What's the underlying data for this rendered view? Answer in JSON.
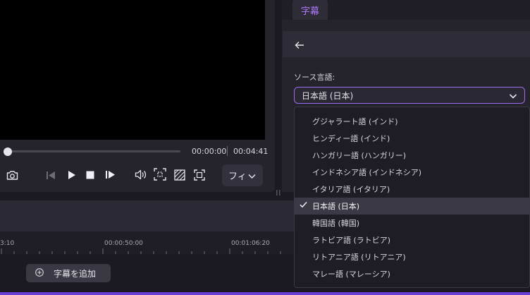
{
  "player": {
    "time_current": "00:00:00",
    "time_total": "00:04:41",
    "progress": 0.0,
    "filter_label": "フィ"
  },
  "timeline": {
    "ticks": [
      "3:10",
      "00:00:50:00",
      "00:01:06:20"
    ],
    "add_subtitle_label": "字幕を追加"
  },
  "subtitle_panel": {
    "tab_label": "字幕",
    "source_language_label": "ソース言語:",
    "selected_language": "日本語 (日本)",
    "options": [
      {
        "label": "グジャラート語 (インド)",
        "selected": false
      },
      {
        "label": "ヒンディー語 (インド)",
        "selected": false
      },
      {
        "label": "ハンガリー語 (ハンガリー)",
        "selected": false
      },
      {
        "label": "インドネシア語 (インドネシア)",
        "selected": false
      },
      {
        "label": "イタリア語 (イタリア)",
        "selected": false
      },
      {
        "label": "日本語 (日本)",
        "selected": true
      },
      {
        "label": "韓国語 (韓国)",
        "selected": false
      },
      {
        "label": "ラトビア語 (ラトビア)",
        "selected": false
      },
      {
        "label": "リトアニア語 (リトアニア)",
        "selected": false
      },
      {
        "label": "マレー語 (マレーシア)",
        "selected": false
      }
    ]
  },
  "colors": {
    "accent": "#9b6cf0",
    "tab_text": "#b07cff",
    "bottom_bar": "#6a3fd6"
  }
}
